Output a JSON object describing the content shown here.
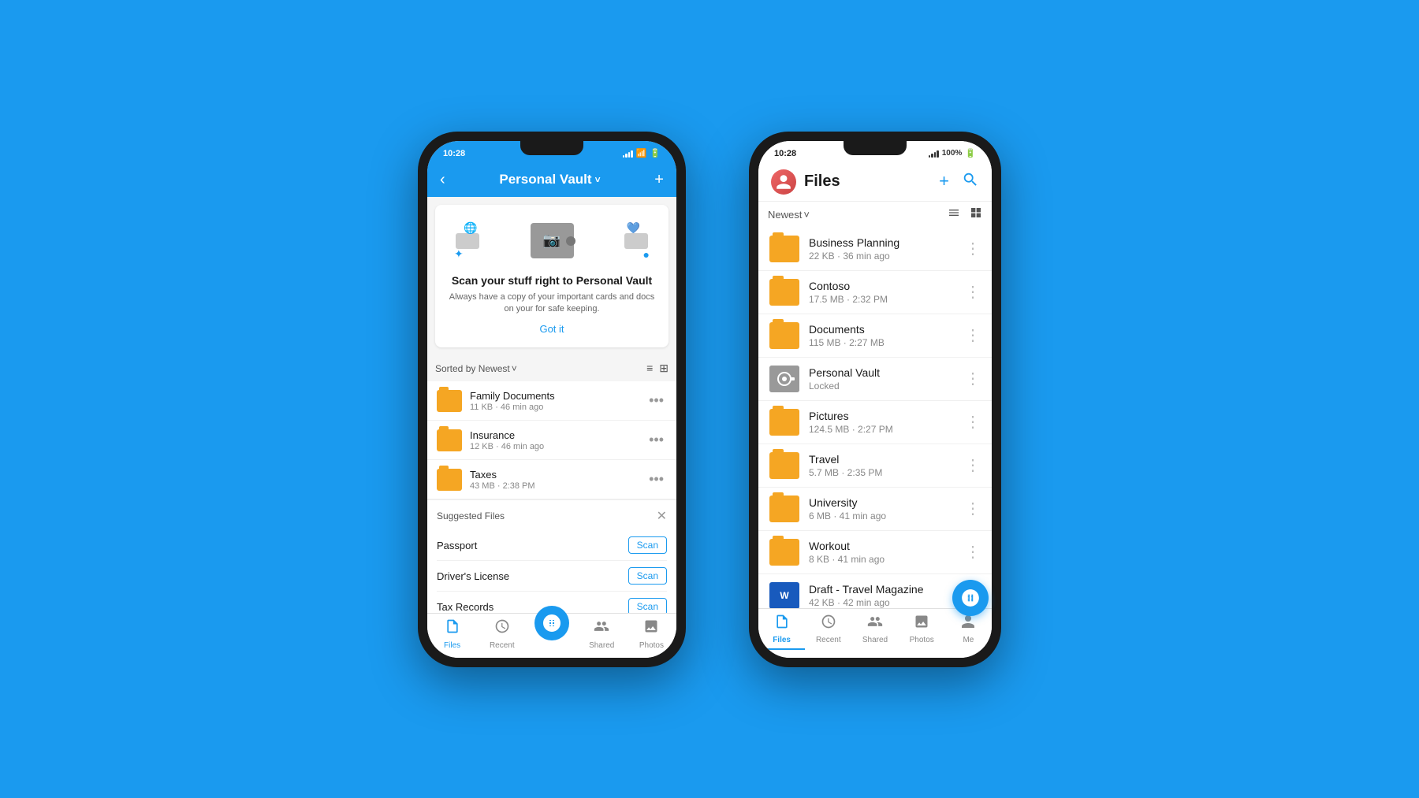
{
  "background": "#1a9aef",
  "phone_left": {
    "status": {
      "time": "10:28",
      "signal": "full",
      "wifi": true,
      "battery": "full"
    },
    "header": {
      "back_label": "‹",
      "title": "Personal Vault",
      "title_caret": "˅",
      "add_label": "+"
    },
    "banner": {
      "title": "Scan your stuff right to Personal Vault",
      "subtitle": "Always have a copy of your important cards and docs on your for safe keeping.",
      "cta": "Got it"
    },
    "sort": {
      "label": "Sorted by Newest",
      "caret": "˅"
    },
    "folders": [
      {
        "name": "Family Documents",
        "meta": "11 KB · 46 min ago"
      },
      {
        "name": "Insurance",
        "meta": "12 KB · 46 min ago"
      },
      {
        "name": "Taxes",
        "meta": "43 MB · 2:38 PM"
      }
    ],
    "suggested": {
      "title": "Suggested Files",
      "items": [
        {
          "name": "Passport",
          "action": "Scan"
        },
        {
          "name": "Driver's License",
          "action": "Scan"
        },
        {
          "name": "Tax Records",
          "action": "Scan"
        }
      ]
    },
    "tabs": [
      {
        "id": "files",
        "label": "Files",
        "icon": "📄",
        "active": true
      },
      {
        "id": "recent",
        "label": "Recent",
        "icon": "🕐",
        "active": false
      },
      {
        "id": "scan",
        "label": "",
        "icon": "⊕",
        "active": false,
        "is_scan": true
      },
      {
        "id": "shared",
        "label": "Shared",
        "icon": "👤",
        "active": false
      },
      {
        "id": "photos",
        "label": "Photos",
        "icon": "🖼",
        "active": false
      }
    ]
  },
  "phone_right": {
    "status": {
      "time": "10:28",
      "signal": "full",
      "battery_pct": "100%",
      "battery_full": true
    },
    "header": {
      "title": "Files",
      "add_label": "+",
      "search_label": "🔍"
    },
    "filter": {
      "label": "Newest",
      "caret": "˅"
    },
    "files": [
      {
        "name": "Business Planning",
        "meta": "22 KB · 36 min ago",
        "type": "folder"
      },
      {
        "name": "Contoso",
        "meta": "17.5 MB · 2:32 PM",
        "type": "folder"
      },
      {
        "name": "Documents",
        "meta": "115 MB · 2:27 MB",
        "type": "folder"
      },
      {
        "name": "Personal Vault",
        "meta": "Locked",
        "type": "vault"
      },
      {
        "name": "Pictures",
        "meta": "124.5 MB · 2:27 PM",
        "type": "folder"
      },
      {
        "name": "Travel",
        "meta": "5.7 MB · 2:35 PM",
        "type": "folder"
      },
      {
        "name": "University",
        "meta": "6 MB · 41 min ago",
        "type": "folder"
      },
      {
        "name": "Workout",
        "meta": "8 KB · 41 min ago",
        "type": "folder"
      },
      {
        "name": "Draft - Travel Magazine",
        "meta": "42 KB · 42 min ago",
        "type": "word"
      }
    ],
    "fab_icon": "⊕",
    "tabs": [
      {
        "id": "files",
        "label": "Files",
        "active": true
      },
      {
        "id": "recent",
        "label": "Recent",
        "active": false
      },
      {
        "id": "shared",
        "label": "Shared",
        "active": false
      },
      {
        "id": "photos",
        "label": "Photos",
        "active": false
      },
      {
        "id": "me",
        "label": "Me",
        "active": false
      }
    ]
  }
}
